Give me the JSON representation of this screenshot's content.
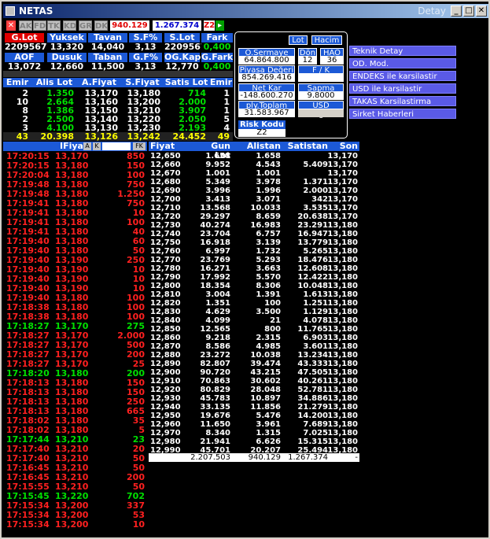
{
  "window": {
    "title": "NETAS",
    "right_title": "Detay"
  },
  "toolbar": {
    "close": "✕",
    "buttons": [
      "AK",
      "FD",
      "TK",
      "KD",
      "GR",
      "DK"
    ],
    "value1": "940.129",
    "value2": "1.267.374",
    "z2": "Z2"
  },
  "summary": {
    "row1_head": [
      "G.Lot",
      "Yuksek",
      "Tavan",
      "S.F%",
      "S.Lot",
      "Fark"
    ],
    "row1_val": [
      "2209567",
      "13,320",
      "14,040",
      "3,13",
      "2209567",
      "0,400"
    ],
    "row2_head": [
      "AOF",
      "Dusuk",
      "Taban",
      "G.F%",
      "OG.Kap.",
      "G.Fark"
    ],
    "row2_val": [
      "13,072",
      "12,660",
      "11,500",
      "3,13",
      "12,770",
      "0,400"
    ]
  },
  "depth": {
    "head": [
      "Emir",
      "Alis Lot",
      "A.Fiyat",
      "S.Fiyat",
      "Satis Lot",
      "Emir"
    ],
    "rows": [
      [
        "2",
        "1.350",
        "13,170",
        "13,180",
        "714",
        "1"
      ],
      [
        "10",
        "2.664",
        "13,160",
        "13,200",
        "2.000",
        "1"
      ],
      [
        "8",
        "1.386",
        "13,150",
        "13,210",
        "3.907",
        "1"
      ],
      [
        "2",
        "2.500",
        "13,140",
        "13,220",
        "2.050",
        "5"
      ],
      [
        "3",
        "4.100",
        "13,130",
        "13,230",
        "2.193",
        "4"
      ]
    ],
    "total": [
      "43",
      "20.398",
      "13,126",
      "13,242",
      "24.452",
      "49"
    ]
  },
  "popup": {
    "lot": "Lot",
    "hacim": "Hacim",
    "osermaye_label": "O.Sermaye",
    "osermaye": "64.864.800",
    "don_label": "Dön",
    "don": "12",
    "hao_label": "HAO",
    "hao": "36",
    "piyasa_label": "Piyasa Değeri",
    "piyasa": "854.269.416",
    "fk_label": "F / K",
    "fk": "",
    "netkar_label": "Net Kar",
    "netkar": "-148.600.270",
    "sapma_label": "Sapma",
    "sapma": "9.8000",
    "ply_label": "ply.Toplam Lot",
    "ply": "31.583.967",
    "usd_label": "USD Değeri",
    "risk_label": "Risk Kodu",
    "risk": "Z2"
  },
  "menu": [
    "Teknik Detay",
    "OD. Mod.",
    "ENDEKS ile karsilastir",
    "USD ile karsilastir",
    "TAKAS Karsilastirma",
    "Sirket Haberleri"
  ],
  "trades": {
    "head": [
      "IFiyat",
      "A",
      "K",
      "",
      "FK"
    ],
    "rows": [
      [
        "17:20:15",
        "13,170",
        "850",
        "r"
      ],
      [
        "17:20:15",
        "13,180",
        "150",
        "r"
      ],
      [
        "17:20:04",
        "13,180",
        "100",
        "r"
      ],
      [
        "17:19:48",
        "13,180",
        "750",
        "r"
      ],
      [
        "17:19:48",
        "13,180",
        "1.250",
        "r"
      ],
      [
        "17:19:41",
        "13,180",
        "750",
        "r"
      ],
      [
        "17:19:41",
        "13,180",
        "10",
        "r"
      ],
      [
        "17:19:41",
        "13,180",
        "100",
        "r"
      ],
      [
        "17:19:41",
        "13,180",
        "40",
        "r"
      ],
      [
        "17:19:40",
        "13,180",
        "60",
        "r"
      ],
      [
        "17:19:40",
        "13,180",
        "50",
        "r"
      ],
      [
        "17:19:40",
        "13,190",
        "250",
        "r"
      ],
      [
        "17:19:40",
        "13,190",
        "10",
        "r"
      ],
      [
        "17:19:40",
        "13,190",
        "10",
        "r"
      ],
      [
        "17:19:40",
        "13,190",
        "10",
        "r"
      ],
      [
        "17:19:40",
        "13,180",
        "100",
        "r"
      ],
      [
        "17:18:38",
        "13,180",
        "100",
        "r"
      ],
      [
        "17:18:38",
        "13,180",
        "100",
        "r"
      ],
      [
        "17:18:27",
        "13,170",
        "275",
        "g"
      ],
      [
        "17:18:27",
        "13,170",
        "2.000",
        "r"
      ],
      [
        "17:18:27",
        "13,170",
        "500",
        "r"
      ],
      [
        "17:18:27",
        "13,170",
        "200",
        "r"
      ],
      [
        "17:18:27",
        "13,170",
        "25",
        "r"
      ],
      [
        "17:18:20",
        "13,180",
        "200",
        "g"
      ],
      [
        "17:18:13",
        "13,180",
        "150",
        "r"
      ],
      [
        "17:18:13",
        "13,180",
        "150",
        "r"
      ],
      [
        "17:18:13",
        "13,180",
        "250",
        "r"
      ],
      [
        "17:18:13",
        "13,180",
        "665",
        "r"
      ],
      [
        "17:18:02",
        "13,180",
        "35",
        "r"
      ],
      [
        "17:18:02",
        "13,180",
        "5",
        "r"
      ],
      [
        "17:17:44",
        "13,210",
        "23",
        "g"
      ],
      [
        "17:17:40",
        "13,210",
        "20",
        "r"
      ],
      [
        "17:17:40",
        "13,210",
        "50",
        "r"
      ],
      [
        "17:16:45",
        "13,210",
        "50",
        "r"
      ],
      [
        "17:16:45",
        "13,210",
        "200",
        "r"
      ],
      [
        "17:15:55",
        "13,210",
        "50",
        "r"
      ],
      [
        "17:15:45",
        "13,220",
        "702",
        "g"
      ],
      [
        "17:15:34",
        "13,200",
        "337",
        "r"
      ],
      [
        "17:15:34",
        "13,200",
        "53",
        "r"
      ],
      [
        "17:15:34",
        "13,200",
        "10",
        "r"
      ]
    ]
  },
  "prices": {
    "head": [
      "Fiyat",
      "Gun Lot",
      "Alistan",
      "Satistan",
      "Son"
    ],
    "rows": [
      [
        "12,650",
        "1.658",
        "1.658",
        "",
        "13,170"
      ],
      [
        "12,660",
        "9.952",
        "4.543",
        "5.409",
        "13,170"
      ],
      [
        "12,670",
        "1.001",
        "1.001",
        "",
        "13,170"
      ],
      [
        "12,680",
        "5.349",
        "3.978",
        "1.371",
        "13,170"
      ],
      [
        "12,690",
        "3.996",
        "1.996",
        "2.000",
        "13,170"
      ],
      [
        "12,700",
        "3.413",
        "3.071",
        "342",
        "13,170"
      ],
      [
        "12,710",
        "13.568",
        "10.033",
        "3.535",
        "13,170"
      ],
      [
        "12,720",
        "29.297",
        "8.659",
        "20.638",
        "13,170"
      ],
      [
        "12,730",
        "40.274",
        "16.983",
        "23.291",
        "13,180"
      ],
      [
        "12,740",
        "23.704",
        "6.757",
        "16.947",
        "13,180"
      ],
      [
        "12,750",
        "16.918",
        "3.139",
        "13.779",
        "13,180"
      ],
      [
        "12,760",
        "6.997",
        "1.732",
        "5.265",
        "13,180"
      ],
      [
        "12,770",
        "23.769",
        "5.293",
        "18.476",
        "13,180"
      ],
      [
        "12,780",
        "16.271",
        "3.663",
        "12.608",
        "13,180"
      ],
      [
        "12,790",
        "17.992",
        "5.570",
        "12.422",
        "13,180"
      ],
      [
        "12,800",
        "18.354",
        "8.306",
        "10.048",
        "13,180"
      ],
      [
        "12,810",
        "3.004",
        "1.391",
        "1.613",
        "13,180"
      ],
      [
        "12,820",
        "1.351",
        "100",
        "1.251",
        "13,180"
      ],
      [
        "12,830",
        "4.629",
        "3.500",
        "1.129",
        "13,180"
      ],
      [
        "12,840",
        "4.099",
        "21",
        "4.078",
        "13,180"
      ],
      [
        "12,850",
        "12.565",
        "800",
        "11.765",
        "13,180"
      ],
      [
        "12,860",
        "9.218",
        "2.315",
        "6.903",
        "13,180"
      ],
      [
        "12,870",
        "8.586",
        "4.985",
        "3.601",
        "13,180"
      ],
      [
        "12,880",
        "23.272",
        "10.038",
        "13.234",
        "13,180"
      ],
      [
        "12,890",
        "82.807",
        "39.474",
        "43.333",
        "13,180"
      ],
      [
        "12,900",
        "90.720",
        "43.215",
        "47.505",
        "13,180"
      ],
      [
        "12,910",
        "70.863",
        "30.602",
        "40.261",
        "13,180"
      ],
      [
        "12,920",
        "80.829",
        "28.048",
        "52.781",
        "13,180"
      ],
      [
        "12,930",
        "45.783",
        "10.897",
        "34.886",
        "13,180"
      ],
      [
        "12,940",
        "33.135",
        "11.856",
        "21.279",
        "13,180"
      ],
      [
        "12,950",
        "19.676",
        "5.476",
        "14.200",
        "13,180"
      ],
      [
        "12,960",
        "11.650",
        "3.961",
        "7.689",
        "13,180"
      ],
      [
        "12,970",
        "8.340",
        "1.315",
        "7.025",
        "13,180"
      ],
      [
        "12,980",
        "21.941",
        "6.626",
        "15.315",
        "13,180"
      ],
      [
        "12,990",
        "45.701",
        "20.207",
        "25.494",
        "13,180"
      ]
    ],
    "total": [
      "",
      "2.207.503",
      "940.129",
      "1.267.374",
      "-"
    ]
  }
}
